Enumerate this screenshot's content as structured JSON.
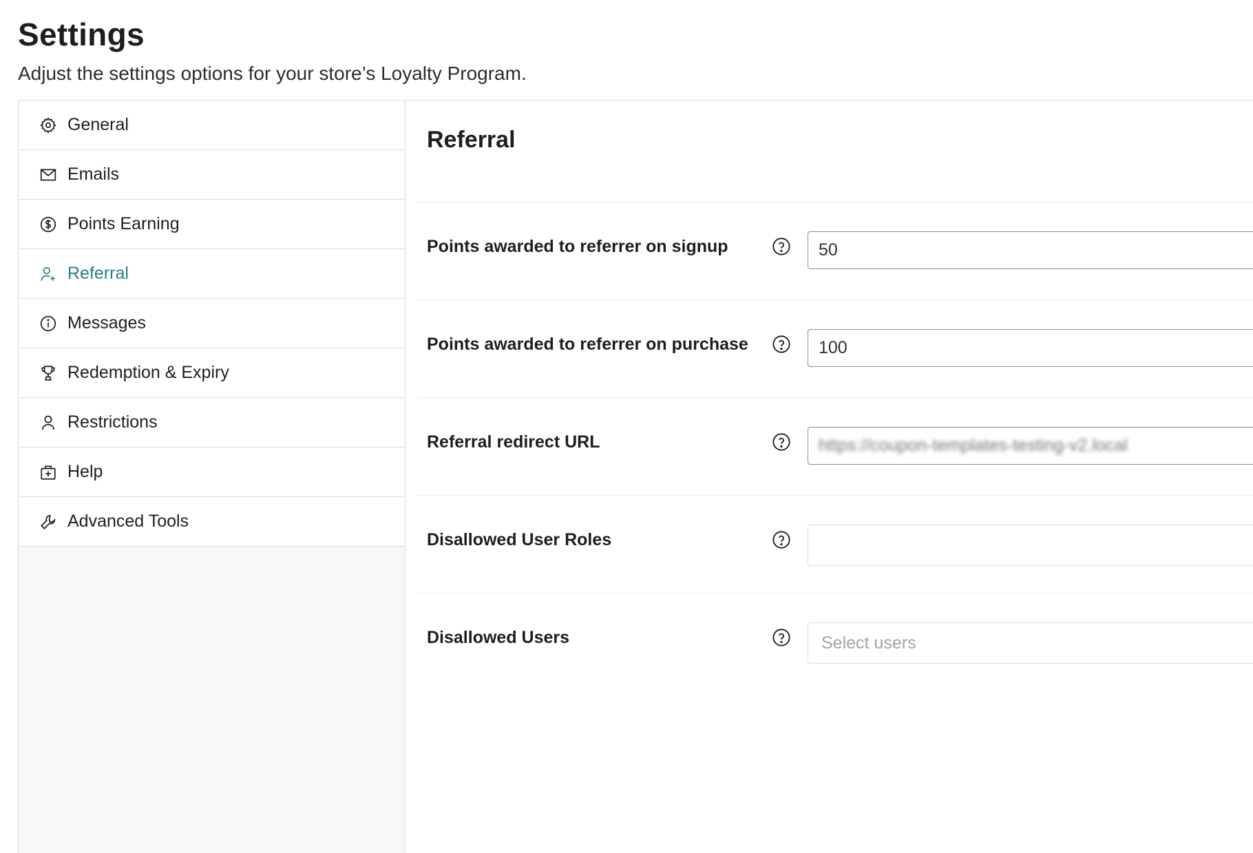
{
  "header": {
    "title": "Settings",
    "subtitle": "Adjust the settings options for your store’s Loyalty Program."
  },
  "sidebar": {
    "items": [
      {
        "label": "General",
        "icon": "gear-icon"
      },
      {
        "label": "Emails",
        "icon": "envelope-icon"
      },
      {
        "label": "Points Earning",
        "icon": "dollar-circle-icon"
      },
      {
        "label": "Referral",
        "icon": "user-plus-icon",
        "active": true
      },
      {
        "label": "Messages",
        "icon": "info-circle-icon"
      },
      {
        "label": "Redemption & Expiry",
        "icon": "trophy-icon"
      },
      {
        "label": "Restrictions",
        "icon": "user-icon"
      },
      {
        "label": "Help",
        "icon": "help-kit-icon"
      },
      {
        "label": "Advanced Tools",
        "icon": "wrench-icon"
      }
    ]
  },
  "main": {
    "section_title": "Referral",
    "fields": [
      {
        "label": "Points awarded to referrer on signup",
        "value": "50"
      },
      {
        "label": "Points awarded to referrer on purchase",
        "value": "100"
      },
      {
        "label": "Referral redirect URL",
        "value": "https://coupon-templates-testing-v2.local"
      },
      {
        "label": "Disallowed User Roles",
        "value": ""
      },
      {
        "label": "Disallowed Users",
        "placeholder": "Select users"
      }
    ]
  },
  "colors": {
    "accent": "#2c7d8c",
    "border": "#dcdcdc",
    "sidebar_bg": "#f8f8f8"
  }
}
